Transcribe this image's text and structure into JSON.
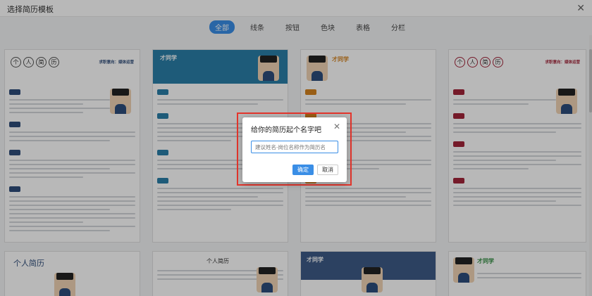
{
  "window": {
    "title": "选择简历模板"
  },
  "tabs": [
    {
      "label": "全部"
    },
    {
      "label": "线条"
    },
    {
      "label": "按钮"
    },
    {
      "label": "色块"
    },
    {
      "label": "表格"
    },
    {
      "label": "分栏"
    }
  ],
  "templates": {
    "t1": {
      "circle_chars": [
        "个",
        "人",
        "简",
        "历"
      ],
      "objective": "求职意向：媒体运营"
    },
    "t2": {
      "name": "才同学"
    },
    "t3": {
      "name": "才同学"
    },
    "t4": {
      "circle_chars": [
        "个",
        "人",
        "简",
        "历"
      ],
      "objective": "求职意向：媒体运营"
    },
    "t5": {
      "title": "个人简历"
    },
    "t6": {
      "title": "个人简历"
    },
    "t7": {
      "name": "才同学"
    },
    "t8": {
      "name": "才同学"
    }
  },
  "dialog": {
    "title": "给你的简历起个名字吧",
    "input_placeholder": "建议姓名-岗位名称作为简历名",
    "confirm_label": "确定",
    "cancel_label": "取消"
  },
  "colors": {
    "accent": "#3a8ee6",
    "highlight": "#e5352c"
  }
}
